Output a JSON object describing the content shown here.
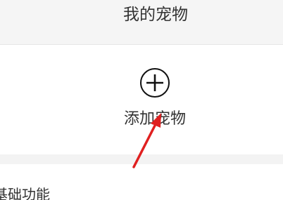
{
  "header": {
    "title": "我的宠物"
  },
  "add_pet": {
    "label": "添加宠物",
    "icon": "plus-circle-icon"
  },
  "section": {
    "title": "基础功能"
  },
  "annotation": {
    "arrow_color": "#e02020"
  }
}
